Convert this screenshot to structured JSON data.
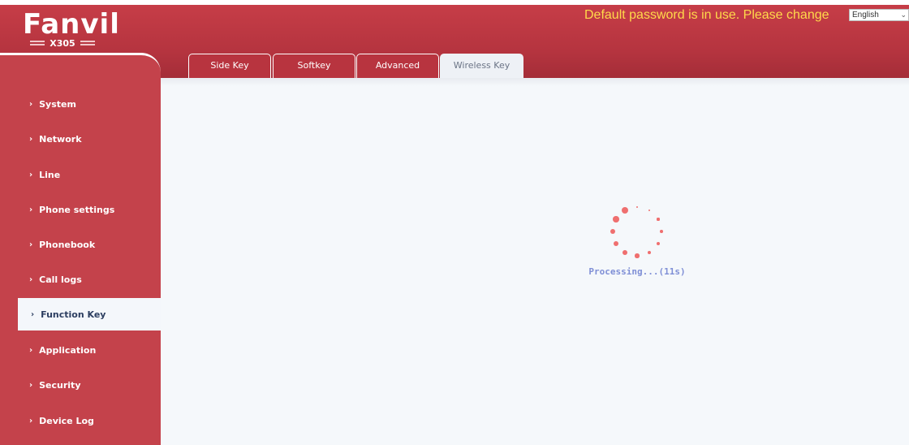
{
  "header": {
    "brand": "Fanvil",
    "model": "X305",
    "warning": "Default password is in use. Please change",
    "language_selected": "English"
  },
  "sidebar": {
    "items": [
      {
        "label": "System",
        "active": false
      },
      {
        "label": "Network",
        "active": false
      },
      {
        "label": "Line",
        "active": false
      },
      {
        "label": "Phone settings",
        "active": false
      },
      {
        "label": "Phonebook",
        "active": false
      },
      {
        "label": "Call logs",
        "active": false
      },
      {
        "label": "Function Key",
        "active": true
      },
      {
        "label": "Application",
        "active": false
      },
      {
        "label": "Security",
        "active": false
      },
      {
        "label": "Device Log",
        "active": false
      }
    ]
  },
  "tabs": [
    {
      "label": "Side Key",
      "active": false
    },
    {
      "label": "Softkey",
      "active": false
    },
    {
      "label": "Advanced",
      "active": false
    },
    {
      "label": "Wireless Key",
      "active": true
    }
  ],
  "main": {
    "status_text": "Processing...(11s)"
  },
  "colors": {
    "header_red": "#b5343f",
    "warning_yellow": "#ffd94a",
    "spinner": "#ef6f6f",
    "status_text": "#7f8fd6"
  },
  "icons": [
    "chevron-right-icon",
    "spinner-icon",
    "chevron-down-icon"
  ]
}
